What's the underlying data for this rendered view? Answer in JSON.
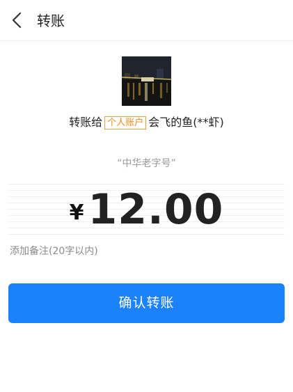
{
  "header": {
    "title": "转账",
    "back_icon": "chevron-left-icon"
  },
  "recipient": {
    "prefix": "转账给",
    "account_tag": "个人账户",
    "name": "会飞的鱼(**虾)",
    "tag_color": "#f08a1c"
  },
  "transfer": {
    "memo": "“中华老字号”",
    "currency_symbol": "¥",
    "amount": "12.00",
    "add_note_label": "添加备注(20字以内)"
  },
  "actions": {
    "confirm_label": "确认转账",
    "confirm_color": "#1b82fb"
  }
}
